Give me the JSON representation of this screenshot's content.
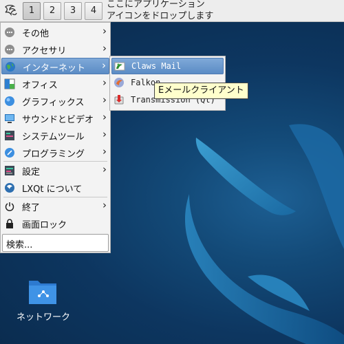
{
  "panel": {
    "desktops": [
      "1",
      "2",
      "3",
      "4"
    ],
    "active_desktop": "1",
    "drop_hint": "ここにアプリケーション\nアイコンをドロップします"
  },
  "menu": {
    "items": [
      {
        "label": "その他",
        "icon": "ellipsis-icon",
        "submenu": true
      },
      {
        "label": "アクセサリ",
        "icon": "ellipsis-icon",
        "submenu": true
      },
      {
        "label": "インターネット",
        "icon": "globe-icon",
        "submenu": true,
        "highlighted": true
      },
      {
        "label": "オフィス",
        "icon": "office-icon",
        "submenu": true
      },
      {
        "label": "グラフィックス",
        "icon": "graphics-icon",
        "submenu": true
      },
      {
        "label": "サウンドとビデオ",
        "icon": "multimedia-icon",
        "submenu": true
      },
      {
        "label": "システムツール",
        "icon": "system-icon",
        "submenu": true
      },
      {
        "label": "プログラミング",
        "icon": "development-icon",
        "submenu": true
      },
      {
        "label": "設定",
        "icon": "settings-icon",
        "submenu": true
      },
      {
        "label": "LXQt について",
        "icon": "lxqt-icon",
        "submenu": false
      },
      {
        "label": "終了",
        "icon": "power-icon",
        "submenu": true
      },
      {
        "label": "画面ロック",
        "icon": "lock-icon",
        "submenu": false
      }
    ],
    "search_placeholder": "検索..."
  },
  "submenu": {
    "items": [
      {
        "label": "Claws Mail",
        "icon": "claws-mail-icon",
        "highlighted": true
      },
      {
        "label": "Falkon",
        "icon": "falkon-icon"
      },
      {
        "label": "Transmission (Qt)",
        "icon": "transmission-icon"
      }
    ]
  },
  "tooltip": "Eメールクライアント",
  "desktop": {
    "icons": [
      {
        "label": "ネットワーク",
        "icon": "network-folder-icon"
      }
    ]
  },
  "colors": {
    "highlight": "#5b8cc5",
    "desktop_bg": "#0d3660",
    "tooltip_bg": "#ffffcc"
  }
}
